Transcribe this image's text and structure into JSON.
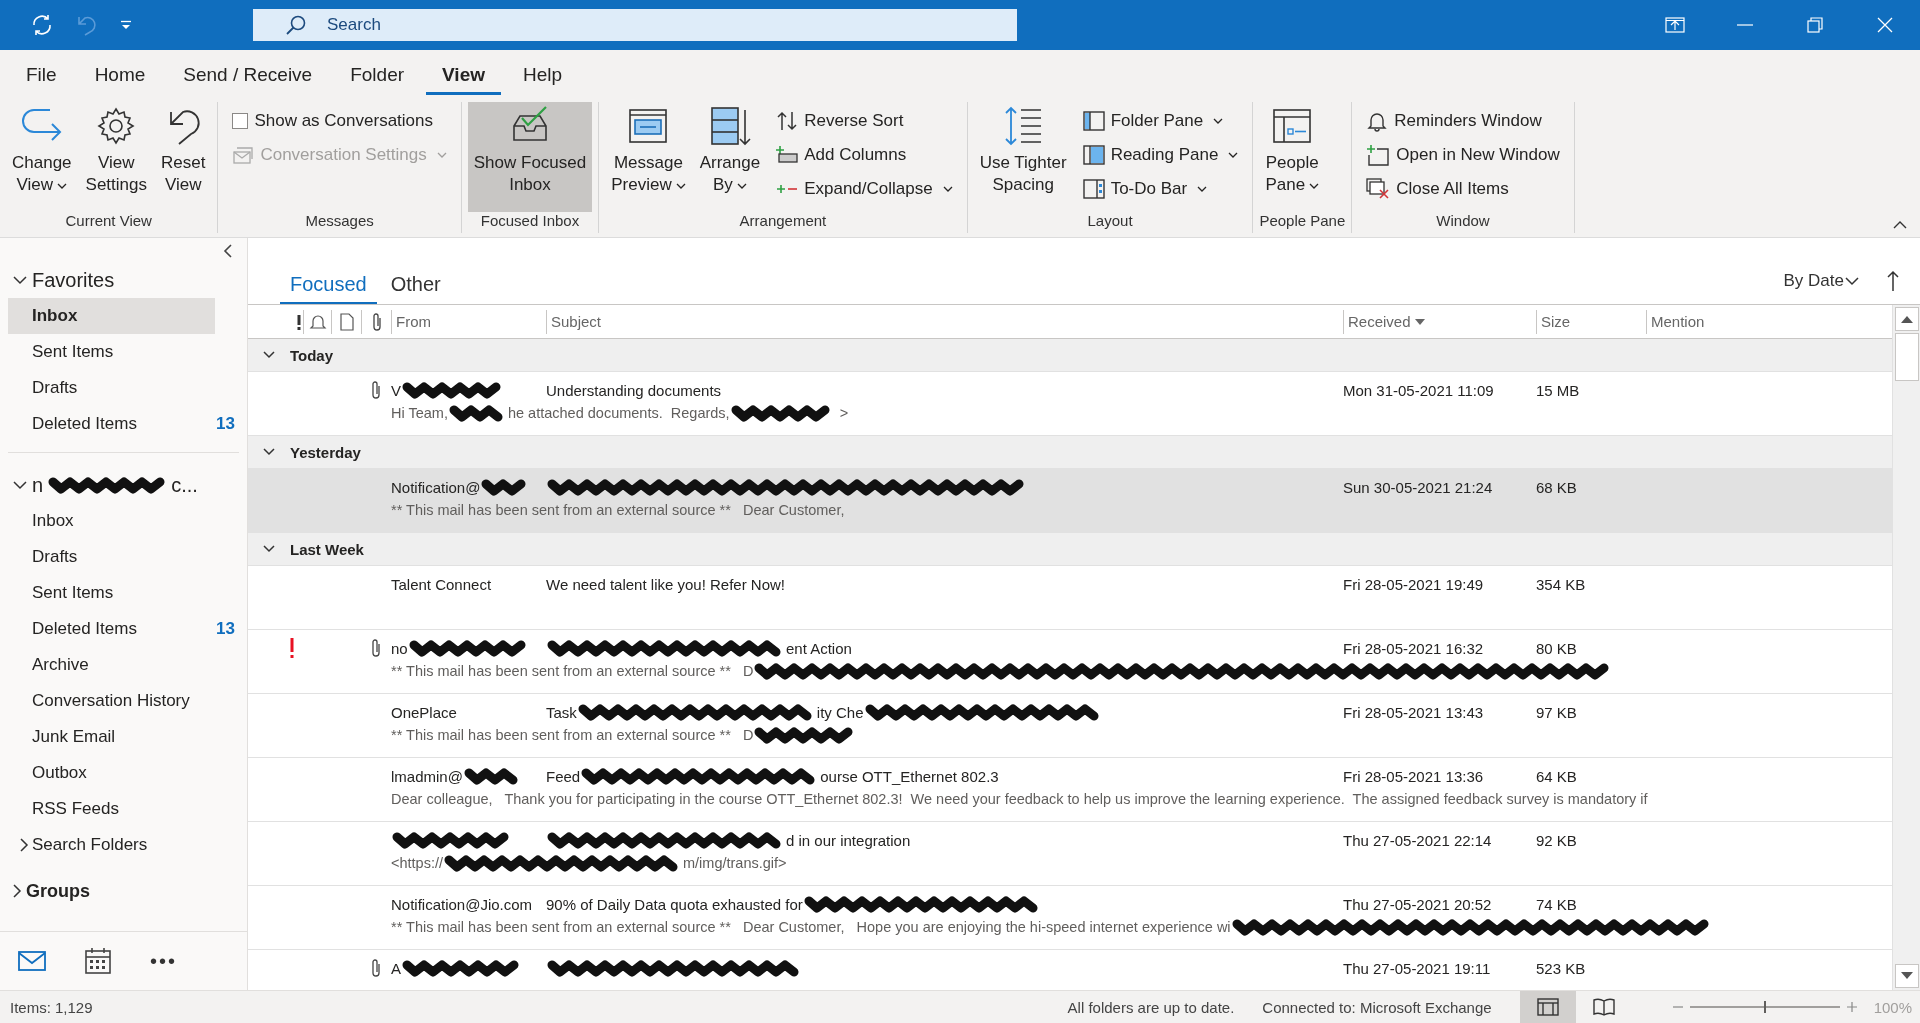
{
  "title_bar": {
    "search_placeholder": "Search",
    "undo_disabled": true
  },
  "menu_tabs": [
    {
      "label": "File",
      "selected": false
    },
    {
      "label": "Home",
      "selected": false
    },
    {
      "label": "Send / Receive",
      "selected": false
    },
    {
      "label": "Folder",
      "selected": false
    },
    {
      "label": "View",
      "selected": true
    },
    {
      "label": "Help",
      "selected": false
    }
  ],
  "ribbon": {
    "groups": [
      {
        "label": "Current View",
        "items": [
          {
            "kind": "large",
            "lines": [
              "Change",
              "View"
            ],
            "dropdown": true
          },
          {
            "kind": "large",
            "lines": [
              "View",
              "Settings"
            ],
            "dropdown": false
          },
          {
            "kind": "large",
            "lines": [
              "Reset",
              "View"
            ],
            "dropdown": false
          }
        ]
      },
      {
        "label": "Messages",
        "items": [
          {
            "kind": "stack",
            "items": [
              {
                "kind": "check",
                "label": "Show as Conversations",
                "checked": false
              },
              {
                "kind": "small",
                "label": "Conversation Settings",
                "dropdown": true,
                "disabled": true
              }
            ]
          }
        ]
      },
      {
        "label": "Focused Inbox",
        "items": [
          {
            "kind": "large",
            "lines": [
              "Show Focused",
              "Inbox"
            ],
            "dropdown": false,
            "on": true
          }
        ]
      },
      {
        "label": "Arrangement",
        "items": [
          {
            "kind": "large",
            "lines": [
              "Message",
              "Preview"
            ],
            "dropdown": true
          },
          {
            "kind": "large",
            "lines": [
              "Arrange",
              "By"
            ],
            "dropdown": true
          },
          {
            "kind": "stack",
            "items": [
              {
                "kind": "small",
                "label": "Reverse Sort",
                "dropdown": false,
                "disabled": false
              },
              {
                "kind": "small",
                "label": "Add Columns",
                "dropdown": false,
                "disabled": false
              },
              {
                "kind": "small",
                "label": "Expand/Collapse",
                "dropdown": true,
                "disabled": false
              }
            ]
          }
        ]
      },
      {
        "label": "Layout",
        "items": [
          {
            "kind": "large",
            "lines": [
              "Use Tighter",
              "Spacing"
            ],
            "dropdown": false
          },
          {
            "kind": "stack",
            "items": [
              {
                "kind": "small",
                "label": "Folder Pane",
                "dropdown": true,
                "disabled": false
              },
              {
                "kind": "small",
                "label": "Reading Pane",
                "dropdown": true,
                "disabled": false
              },
              {
                "kind": "small",
                "label": "To-Do Bar",
                "dropdown": true,
                "disabled": false
              }
            ]
          }
        ]
      },
      {
        "label": "People Pane",
        "items": [
          {
            "kind": "large",
            "lines": [
              "People",
              "Pane"
            ],
            "dropdown": true
          }
        ]
      },
      {
        "label": "Window",
        "items": [
          {
            "kind": "stack",
            "items": [
              {
                "kind": "small",
                "label": "Reminders Window",
                "dropdown": false,
                "disabled": false
              },
              {
                "kind": "small",
                "label": "Open in New Window",
                "dropdown": false,
                "disabled": false
              },
              {
                "kind": "small",
                "label": "Close All Items",
                "dropdown": false,
                "disabled": false
              }
            ]
          }
        ]
      }
    ]
  },
  "sidebar": {
    "sections": [
      {
        "kind": "favorites",
        "name": [
          {
            "text": "Favorites"
          }
        ],
        "expanded": true,
        "folders": [
          {
            "label": "Inbox",
            "selected": true
          },
          {
            "label": "Sent Items",
            "selected": false
          },
          {
            "label": "Drafts",
            "selected": false
          },
          {
            "label": "Deleted Items",
            "count": "13",
            "selected": false
          }
        ]
      },
      {
        "kind": "account",
        "name": [
          {
            "text": "n"
          },
          {
            "kind": "scribble"
          },
          {
            "text": "c..."
          }
        ],
        "expanded": true,
        "folders": [
          {
            "label": "Inbox",
            "selected": false
          },
          {
            "label": "Drafts",
            "selected": false
          },
          {
            "label": "Sent Items",
            "selected": false
          },
          {
            "label": "Deleted Items",
            "count": "13",
            "selected": false
          },
          {
            "label": "Archive",
            "selected": false
          },
          {
            "label": "Conversation History",
            "selected": false
          },
          {
            "label": "Junk Email",
            "selected": false
          },
          {
            "label": "Outbox",
            "selected": false
          },
          {
            "label": "RSS Feeds",
            "selected": false
          },
          {
            "label": "Search Folders",
            "expandable": true,
            "selected": false
          }
        ]
      },
      {
        "kind": "groups",
        "name": [
          {
            "text": "Groups"
          }
        ],
        "expanded": false
      }
    ],
    "nav": [
      {
        "kind": "mail",
        "selected": true
      },
      {
        "kind": "calendar",
        "selected": false
      },
      {
        "kind": "more",
        "label": "•••",
        "selected": false
      }
    ]
  },
  "mail": {
    "tabs": [
      {
        "label": "Focused",
        "selected": true
      },
      {
        "label": "Other",
        "selected": false
      }
    ],
    "sort": {
      "label": "By Date"
    },
    "columns": [
      {
        "label": "From",
        "sorted": false
      },
      {
        "label": "Subject",
        "sorted": false
      },
      {
        "label": "Received",
        "sorted": true
      },
      {
        "label": "Size",
        "sorted": false
      },
      {
        "label": "Mention",
        "sorted": false
      }
    ],
    "rows": [
      {
        "kind": "group",
        "label": "Today",
        "expanded": true
      },
      {
        "kind": "mail",
        "selected": false,
        "important": false,
        "attachment": true,
        "from": [
          {
            "text": "V"
          },
          {
            "kind": "scribble"
          }
        ],
        "subject": [
          {
            "text": "Understanding documents"
          }
        ],
        "preview": [
          {
            "text": "Hi Team,"
          },
          {
            "kind": "scribble"
          },
          {
            "text": "he attached documents.  Regards,"
          },
          {
            "kind": "scribble"
          },
          {
            "text": ">"
          }
        ],
        "received": "Mon 31-05-2021 11:09",
        "size": "15 MB"
      },
      {
        "kind": "group",
        "label": "Yesterday",
        "expanded": true
      },
      {
        "kind": "mail",
        "selected": true,
        "important": false,
        "attachment": false,
        "from": [
          {
            "text": "Notification@"
          },
          {
            "kind": "scribble"
          }
        ],
        "subject": [
          {
            "kind": "scribble"
          }
        ],
        "preview": [
          {
            "text": "** This mail has been sent from an external source **   Dear Customer,"
          }
        ],
        "received": "Sun 30-05-2021 21:24",
        "size": "68 KB"
      },
      {
        "kind": "group",
        "label": "Last Week",
        "expanded": true
      },
      {
        "kind": "mail",
        "selected": false,
        "important": false,
        "attachment": false,
        "from": [
          {
            "text": "Talent Connect"
          }
        ],
        "subject": [
          {
            "text": "We need talent like you! Refer Now!"
          }
        ],
        "received": "Fri 28-05-2021 19:49",
        "size": "354 KB"
      },
      {
        "kind": "mail",
        "selected": false,
        "important": true,
        "attachment": true,
        "from": [
          {
            "text": "no"
          },
          {
            "kind": "scribble"
          }
        ],
        "subject": [
          {
            "kind": "scribble"
          },
          {
            "text": "ent Action"
          }
        ],
        "preview": [
          {
            "text": "** This mail has been sent from an external source **   D"
          },
          {
            "kind": "scribble"
          }
        ],
        "received": "Fri 28-05-2021 16:32",
        "size": "80 KB"
      },
      {
        "kind": "mail",
        "selected": false,
        "important": false,
        "attachment": false,
        "from": [
          {
            "text": "OnePlace"
          }
        ],
        "subject": [
          {
            "text": "Task"
          },
          {
            "kind": "scribble"
          },
          {
            "text": "ity Che"
          },
          {
            "kind": "scribble"
          }
        ],
        "preview": [
          {
            "text": "** This mail has been sent from an external source **   D"
          },
          {
            "kind": "scribble"
          }
        ],
        "received": "Fri 28-05-2021 13:43",
        "size": "97 KB"
      },
      {
        "kind": "mail",
        "selected": false,
        "important": false,
        "attachment": false,
        "from": [
          {
            "text": "lmadmin@"
          },
          {
            "kind": "scribble"
          }
        ],
        "subject": [
          {
            "text": "Feed"
          },
          {
            "kind": "scribble"
          },
          {
            "text": "ourse OTT_Ethernet 802.3"
          }
        ],
        "preview": [
          {
            "text": "Dear colleague,   Thank you for participating in the course OTT_Ethernet 802.3!  We need your feedback to help us improve the learning experience.  The assigned feedback survey is mandatory if"
          }
        ],
        "received": "Fri 28-05-2021 13:36",
        "size": "64 KB"
      },
      {
        "kind": "mail",
        "selected": false,
        "important": false,
        "attachment": false,
        "from": [
          {
            "kind": "scribble"
          }
        ],
        "subject": [
          {
            "kind": "scribble"
          },
          {
            "text": "d in our integration"
          }
        ],
        "preview": [
          {
            "text": "<https://"
          },
          {
            "kind": "scribble"
          },
          {
            "text": "m/img/trans.gif>"
          }
        ],
        "received": "Thu 27-05-2021 22:14",
        "size": "92 KB"
      },
      {
        "kind": "mail",
        "selected": false,
        "important": false,
        "attachment": false,
        "from": [
          {
            "text": "Notification@Jio.com"
          }
        ],
        "subject": [
          {
            "text": "90% of Daily Data quota exhausted for"
          },
          {
            "kind": "scribble"
          }
        ],
        "preview": [
          {
            "text": "** This mail has been sent from an external source **   Dear Customer,   Hope you are enjoying the hi-speed internet experience wi"
          },
          {
            "kind": "scribble"
          }
        ],
        "received": "Thu 27-05-2021 20:52",
        "size": "74 KB"
      },
      {
        "kind": "mail",
        "selected": false,
        "important": false,
        "attachment": true,
        "from": [
          {
            "text": "A"
          },
          {
            "kind": "scribble"
          }
        ],
        "subject": [
          {
            "kind": "scribble"
          }
        ],
        "received": "Thu 27-05-2021 19:11",
        "size": "523 KB"
      }
    ]
  },
  "status_bar": {
    "items": "Items: 1,129",
    "sync": "All folders are up to date.",
    "connection": "Connected to: Microsoft Exchange",
    "views": [
      {
        "selected": true
      },
      {
        "selected": false
      }
    ],
    "zoom": {
      "level": 0.5,
      "reading": "100%"
    }
  }
}
